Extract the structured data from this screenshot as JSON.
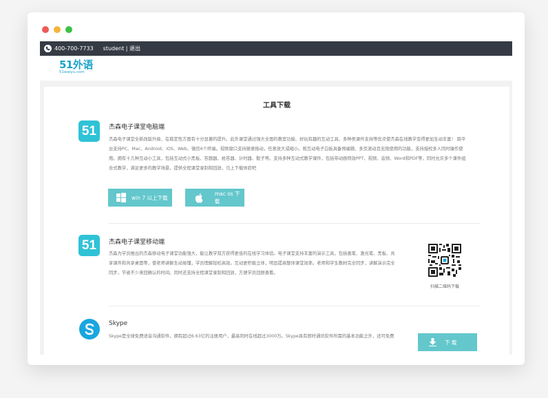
{
  "window": {
    "dots": [
      "#ee5b56",
      "#f5b43c",
      "#3cc146"
    ]
  },
  "topbar": {
    "phone": "400-700-7733",
    "user": "student | 退出"
  },
  "logo": {
    "main": "51外语",
    "sub": "51waiyu.com",
    "color": "#1aa3c9"
  },
  "page": {
    "title": "工具下载"
  },
  "sections": [
    {
      "icon_text": "51",
      "title": "杰森电子课堂电脑端",
      "desc_lines": [
        "杰森电子课堂全新改版升级、在稳定性方面有十分显著的提升。此外课堂通过强大全面的教室功能、好玩有趣的互动工具、多种类课件支持等优点使杰森在线教学变得更加生动丰富！ 跨平",
        "台支持PC、Mac、Android、iOS、Web、微信6个终端。视频窗口支持随意拖动，任意放大或缩小。观互动电子白板具备预编辑、多页滚动且无限使用的功能，支持授权多人同时操作使",
        "用。拥有十几种互动小工具，包括互动式小黑板、答题器、抢答器、计时器、骰子等。支持多种互动式教学课件，包括带动画特效PPT、视频、音频、Word和PDF等，同时允许多个课件组",
        "合式教学，满足更多的教学场景。提供全程课堂录制和回放，马上下载体验吧"
      ],
      "buttons": [
        "win 7 以上下载",
        "mac os 下载"
      ]
    },
    {
      "icon_text": "51",
      "title": "杰森电子课堂移动端",
      "desc_lines": [
        "杰森为学员推出的杰森移动电子课堂功能强大，能让教学双方获得更佳的在线学习体验。电子课堂支持丰富的演示工具，包括画笔、激光笔、黑板、共",
        "享课件和共享桌面等，使老师讲解生动易懂，学员理解轻松高效。互动更积极立体，明显提高整体课堂效率。老师和学生教材完全同步，讲解演示完全",
        "同步，节省不少来回确认的时间。同时还支持全程课堂录制和回放，方便学员回顾查看。"
      ],
      "qr_caption": "扫描二维码下载"
    },
    {
      "title": "Skype",
      "desc": "Skype是全球免费语音沟通软件，拥有超过6.63亿的注册用户，最高同时在线超过3000万。Skype具有即时通讯软件所需的基本功能之外，还可免费",
      "button": "下 载"
    }
  ],
  "colors": {
    "accent": "#2fc2d6",
    "button": "#63c7cc",
    "skype": "#1aa6df",
    "topbar": "#353b44"
  }
}
